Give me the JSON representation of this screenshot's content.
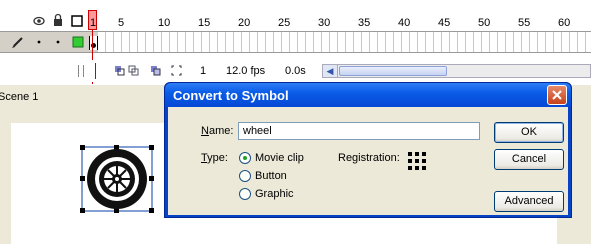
{
  "timeline": {
    "ruler_ticks": [
      "1",
      "5",
      "10",
      "15",
      "20",
      "25",
      "30",
      "35",
      "40",
      "45",
      "50",
      "55",
      "60"
    ],
    "current_frame": "1",
    "fps": "12.0 fps",
    "elapsed": "0.0s"
  },
  "scene": {
    "label": "Scene 1"
  },
  "dialog": {
    "title": "Convert to Symbol",
    "name_label": "Name:",
    "name_value": "wheel",
    "type_label": "Type:",
    "type_options": [
      "Movie clip",
      "Button",
      "Graphic"
    ],
    "type_selected": "Movie clip",
    "registration_label": "Registration:",
    "ok_label": "OK",
    "cancel_label": "Cancel",
    "advanced_label": "Advanced"
  },
  "colors": {
    "accent": "#0843c4",
    "layer_color": "#33cc33",
    "playhead": "#cc0000"
  },
  "icons": [
    "eye-icon",
    "lock-icon",
    "outline-icon",
    "pencil-icon",
    "close-icon",
    "scroll-left-icon",
    "registration-grid-icon",
    "wheel-graphic"
  ]
}
